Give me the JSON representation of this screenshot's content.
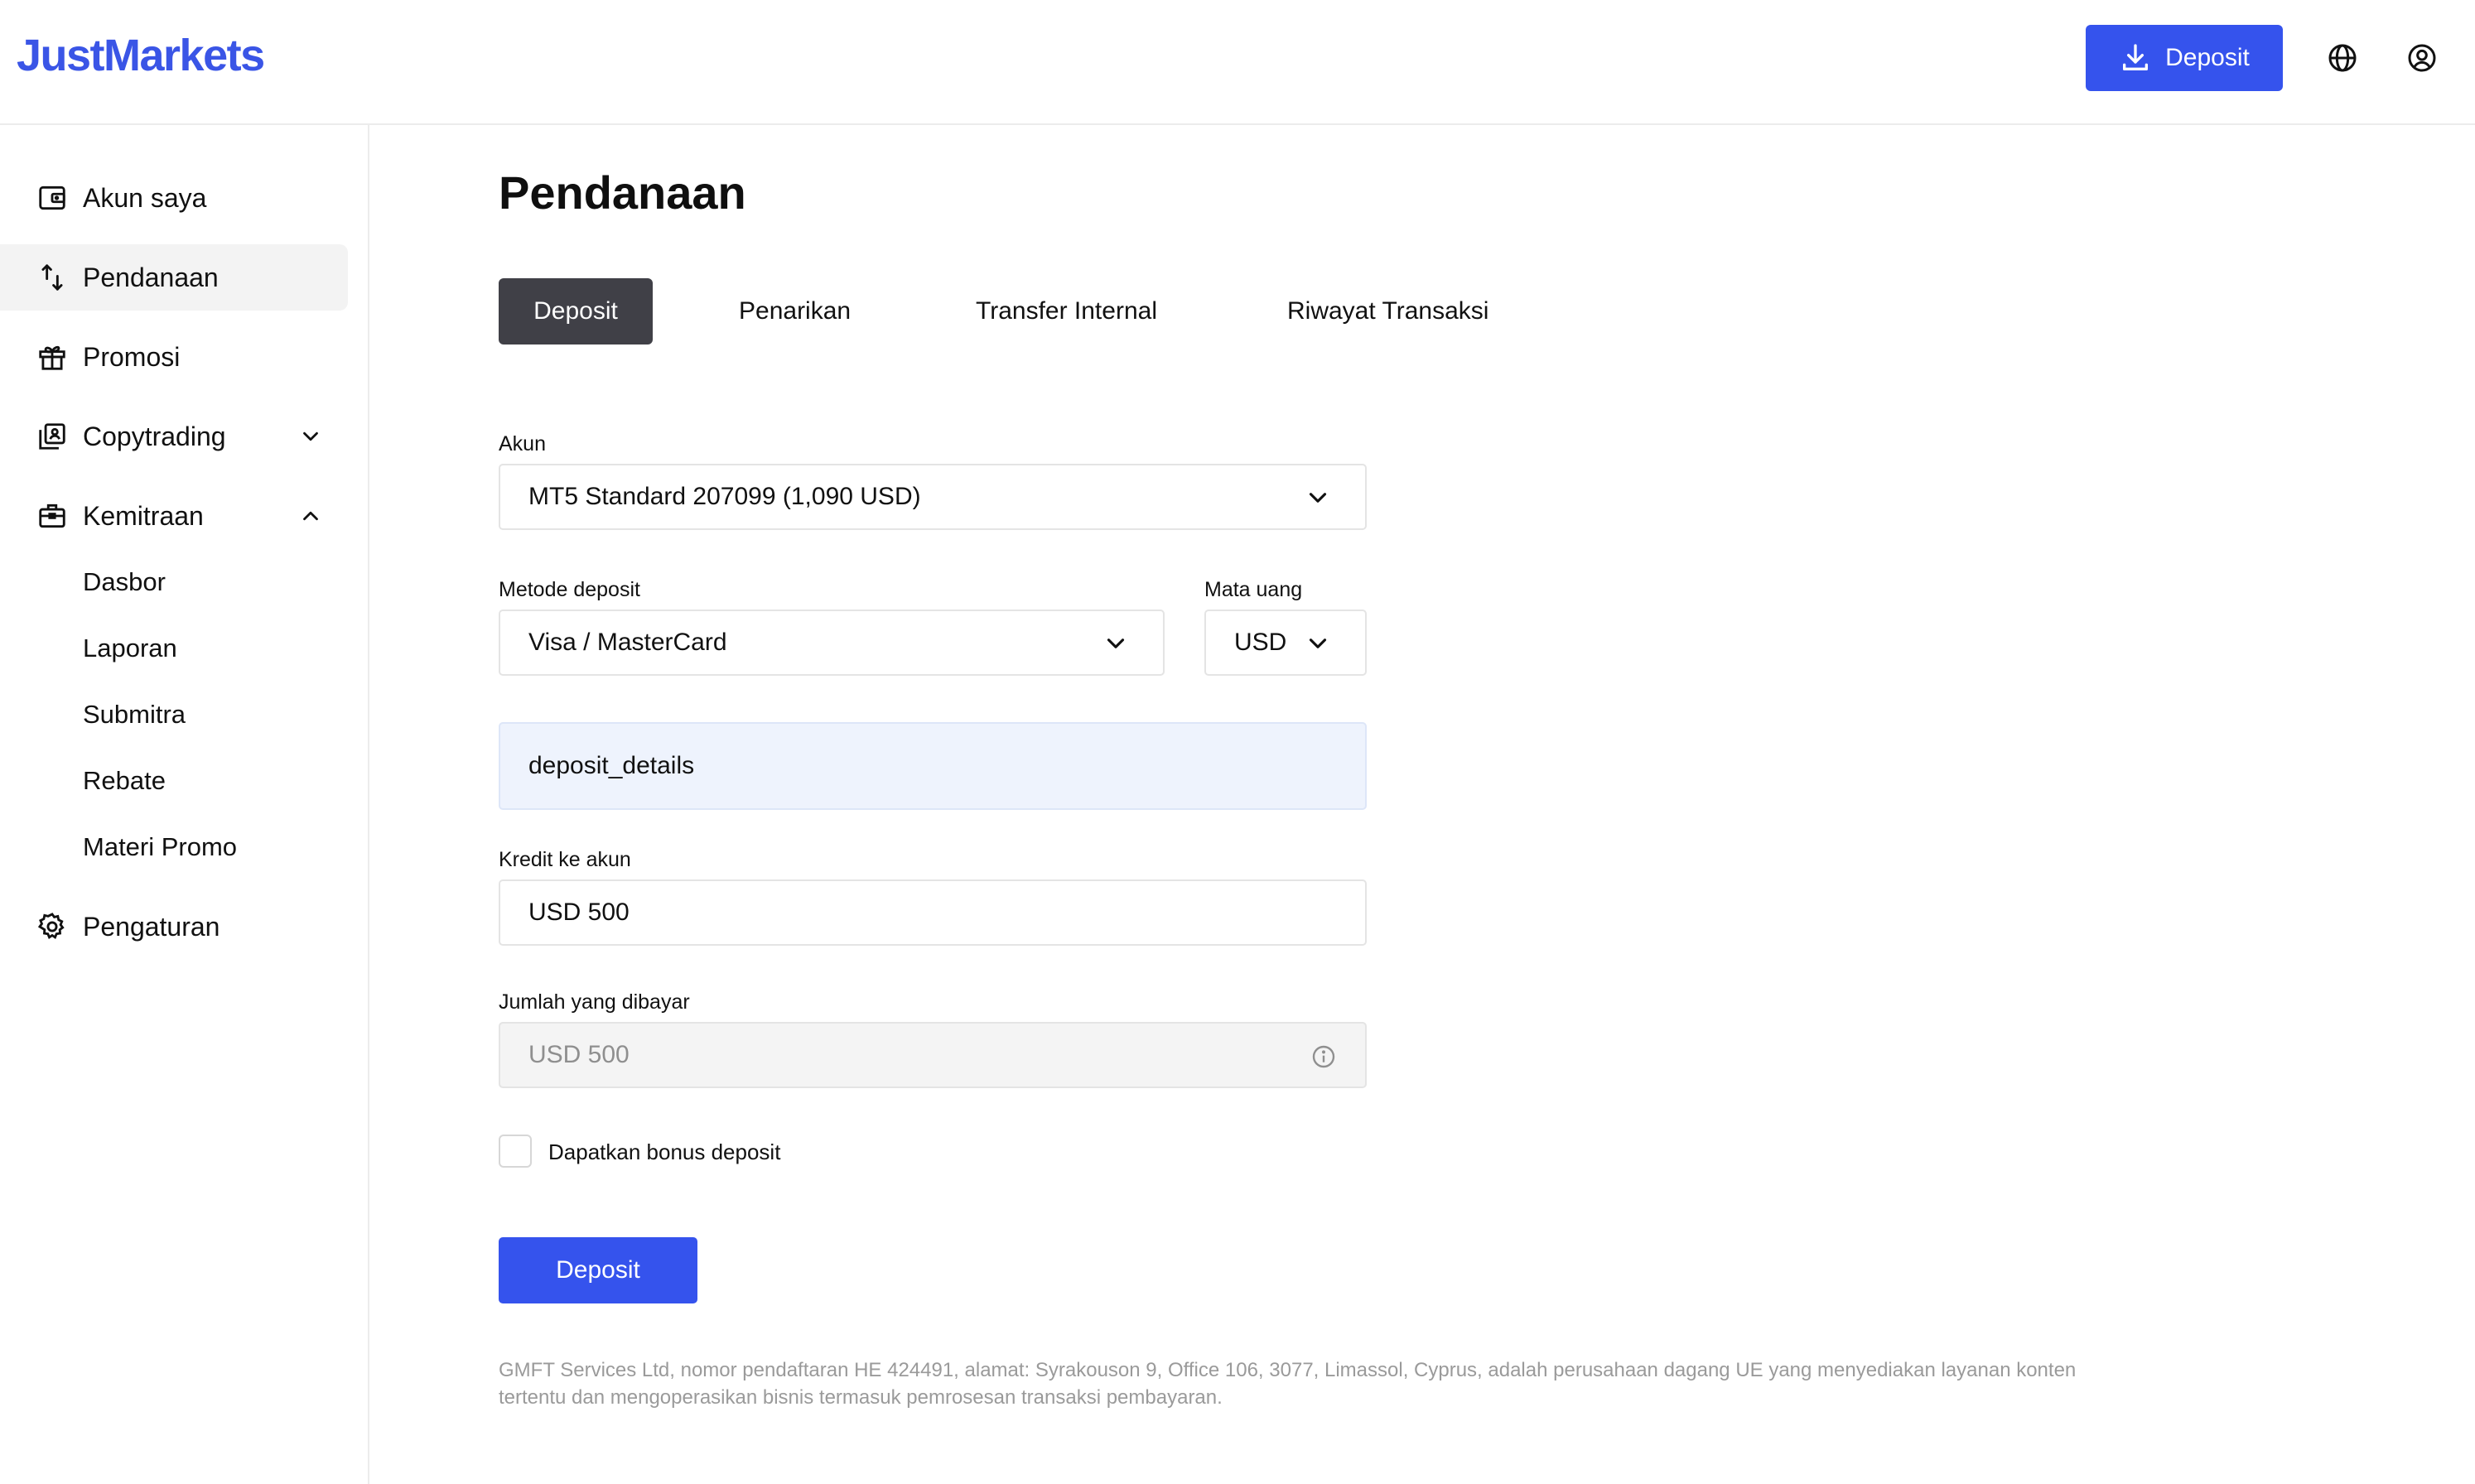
{
  "header": {
    "logo": "JustMarkets",
    "deposit_button": "Deposit",
    "globe_icon": "globe-icon",
    "profile_icon": "user-circle-icon"
  },
  "sidebar": {
    "items": [
      {
        "label": "Akun saya",
        "icon": "wallet-icon"
      },
      {
        "label": "Pendanaan",
        "icon": "transfer-arrows-icon"
      },
      {
        "label": "Promosi",
        "icon": "gift-icon"
      },
      {
        "label": "Copytrading",
        "icon": "copytrading-icon"
      },
      {
        "label": "Kemitraan",
        "icon": "briefcase-icon"
      },
      {
        "label": "Pengaturan",
        "icon": "gear-icon"
      }
    ],
    "sub_items": [
      "Dasbor",
      "Laporan",
      "Submitra",
      "Rebate",
      "Materi Promo"
    ]
  },
  "main": {
    "title": "Pendanaan",
    "tabs": [
      "Deposit",
      "Penarikan",
      "Transfer Internal",
      "Riwayat Transaksi"
    ],
    "account_label": "Akun",
    "account_value": "MT5 Standard 207099 (1,090 USD)",
    "method_label": "Metode deposit",
    "method_value": "Visa / MasterCard",
    "currency_label": "Mata uang",
    "currency_value": "USD",
    "details_text": "deposit_details",
    "credit_label": "Kredit ke akun",
    "credit_value": "USD 500",
    "paid_label": "Jumlah yang dibayar",
    "paid_value": "USD 500",
    "bonus_label": "Dapatkan bonus deposit",
    "submit_label": "Deposit",
    "footer_note": "GMFT Services Ltd, nomor pendaftaran HE 424491, alamat: Syrakouson 9, Office 106, 3077, Limassol, Cyprus, adalah perusahaan dagang UE yang menyediakan layanan konten tertentu dan mengoperasikan bisnis termasuk pemrosesan transaksi pembayaran."
  },
  "colors": {
    "brand": "#3553ed",
    "active_tab": "#404047",
    "details_bg": "#eef3fd"
  }
}
